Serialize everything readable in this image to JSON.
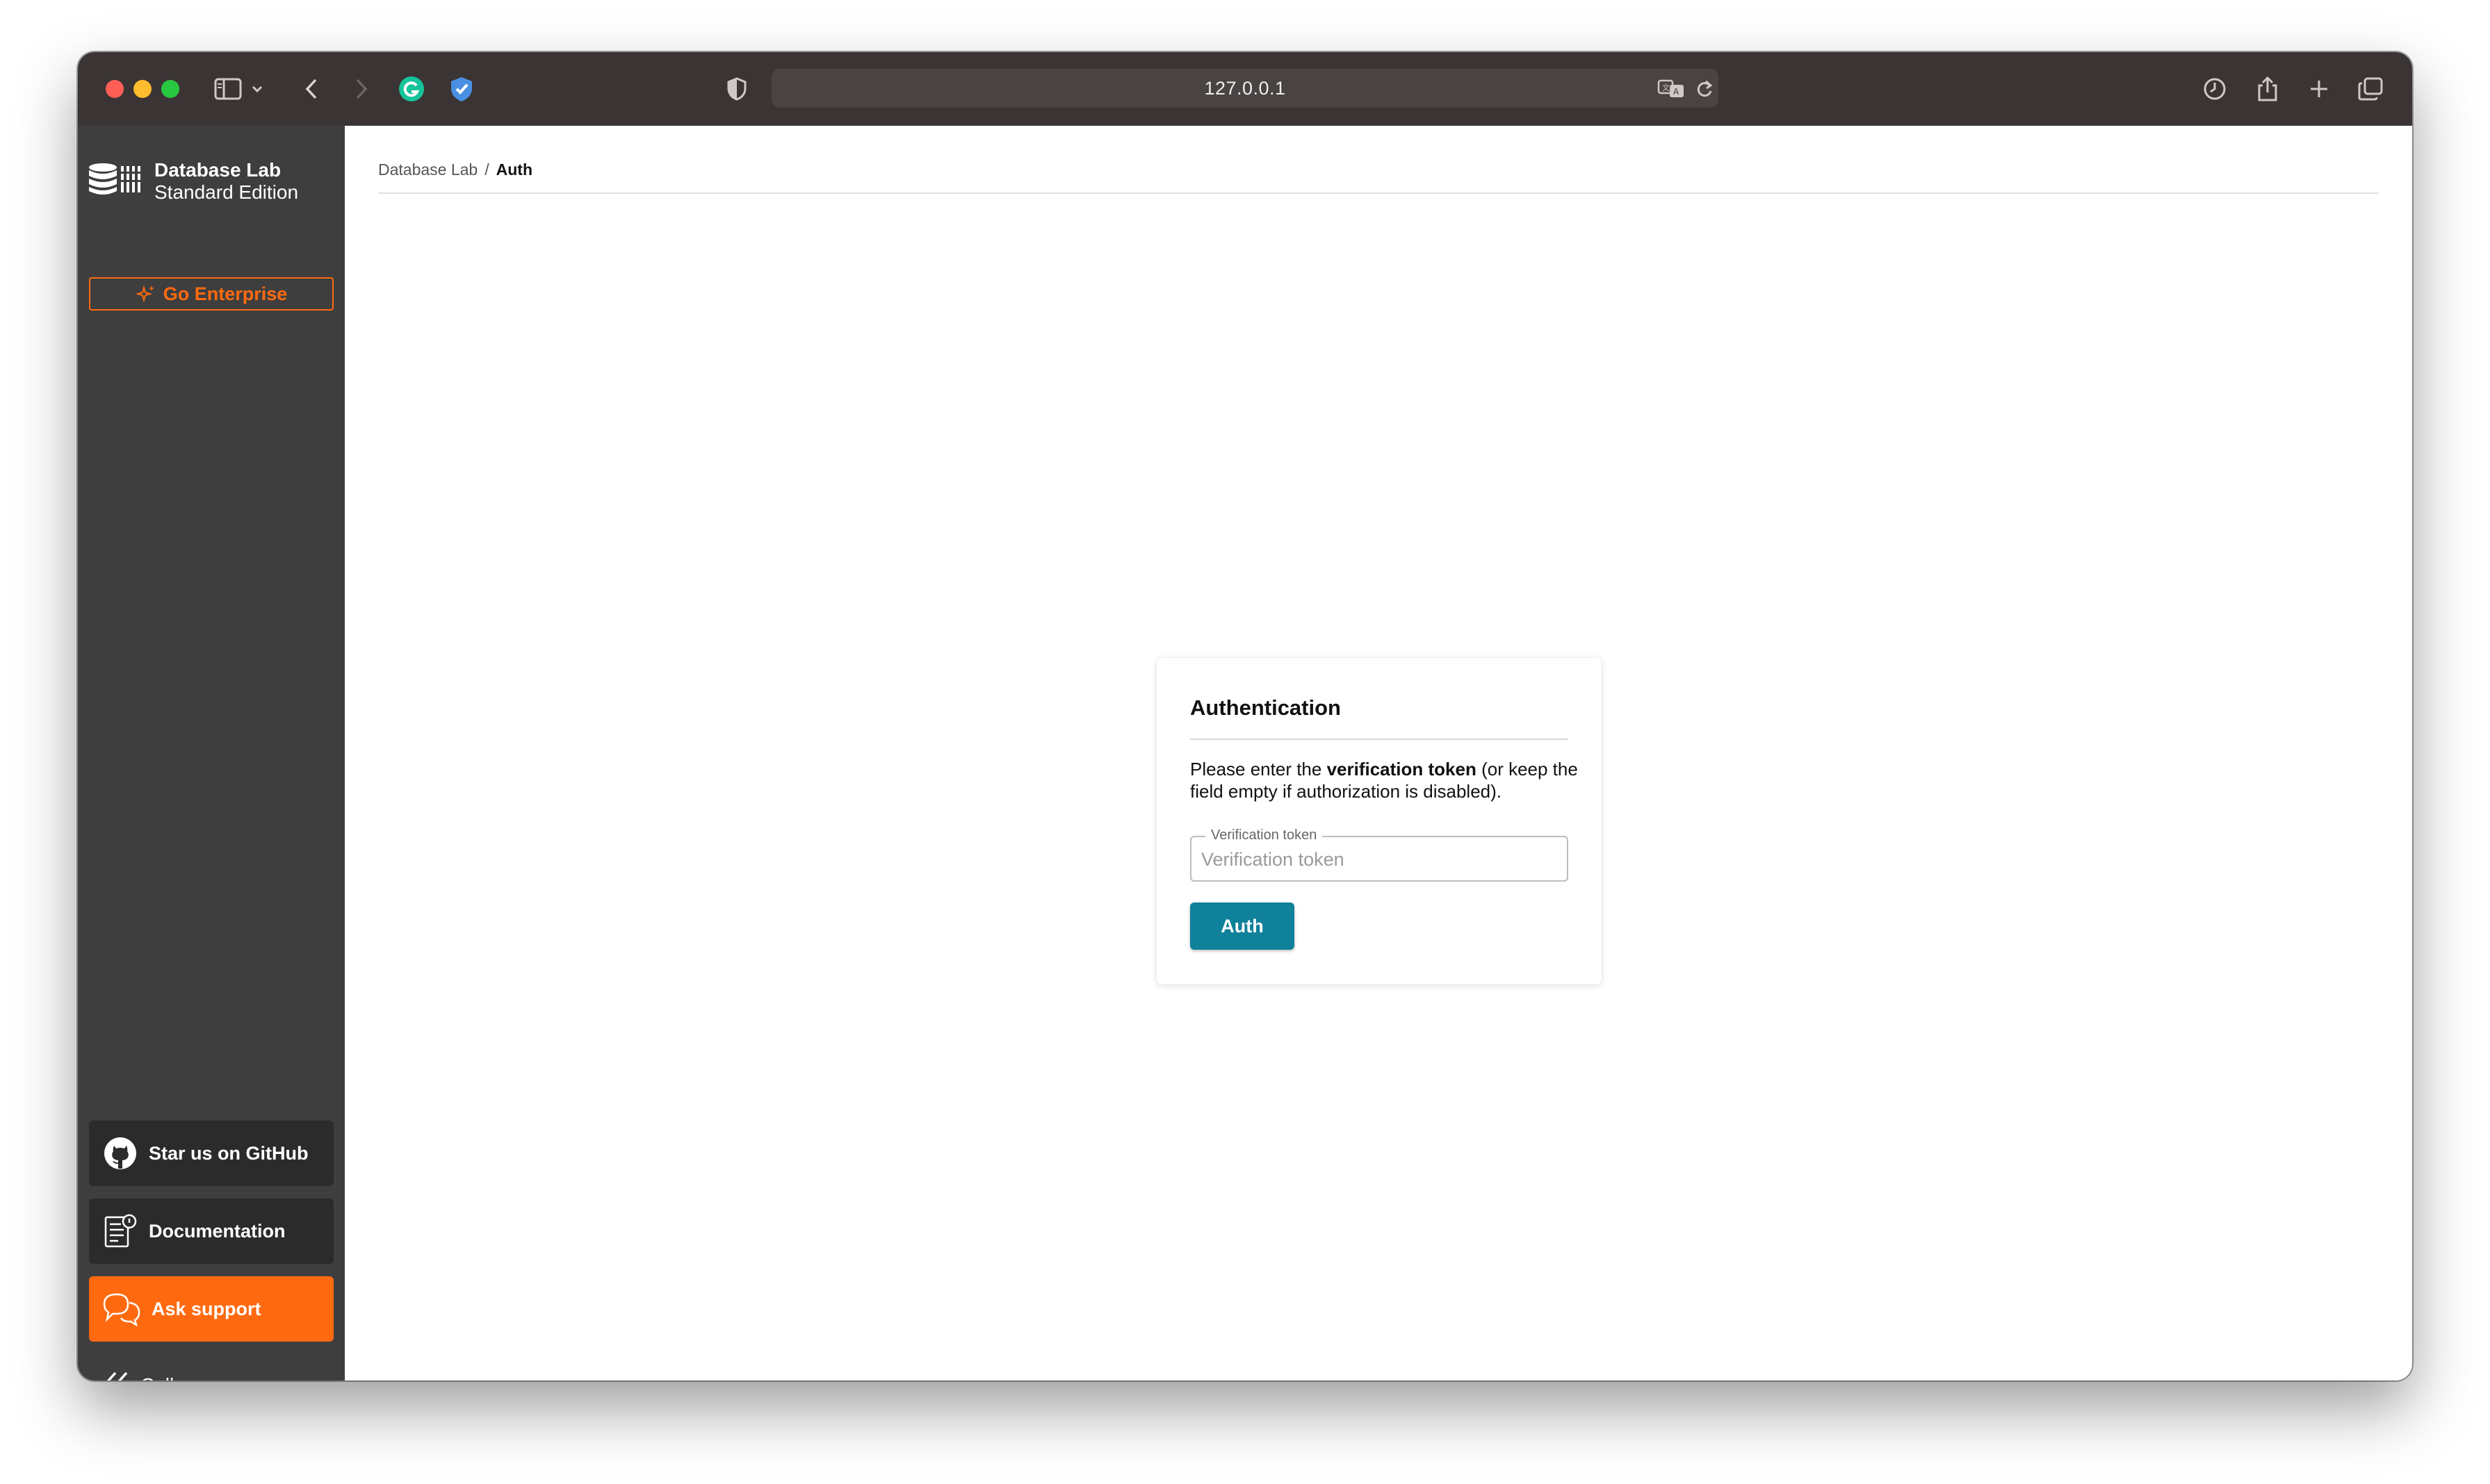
{
  "browser": {
    "url": "127.0.0.1"
  },
  "sidebar": {
    "brand_title": "Database Lab",
    "brand_subtitle": "Standard Edition",
    "enterprise_label": "Go Enterprise",
    "github_label": "Star us on GitHub",
    "docs_label": "Documentation",
    "support_label": "Ask support",
    "collapse_label": "Collapse"
  },
  "breadcrumb": {
    "root": "Database Lab",
    "separator": "/",
    "current": "Auth"
  },
  "auth": {
    "title": "Authentication",
    "desc_before": "Please enter the ",
    "desc_bold": "verification token",
    "desc_after": " (or keep the field empty if authorization is disabled).",
    "field_label": "Verification token",
    "field_placeholder": "Verification token",
    "field_value": "",
    "button_label": "Auth"
  },
  "colors": {
    "sidebar_bg": "#3e3e3e",
    "accent_orange": "#ff6a10",
    "button_teal": "#10819a",
    "toolbar_bg": "#3b3434"
  },
  "icons": {
    "toolbar": [
      "sidebar-toggle-icon",
      "chevron-down-icon",
      "back-icon",
      "forward-icon",
      "grammarly-icon",
      "shield-check-icon",
      "privacy-shield-icon",
      "translate-icon",
      "reload-icon",
      "history-icon",
      "share-icon",
      "new-tab-icon",
      "tabs-overview-icon"
    ],
    "sidebar": [
      "database-logo-icon",
      "sparkle-icon",
      "github-icon",
      "documentation-icon",
      "chat-bubbles-icon",
      "double-chevron-left-icon"
    ]
  }
}
